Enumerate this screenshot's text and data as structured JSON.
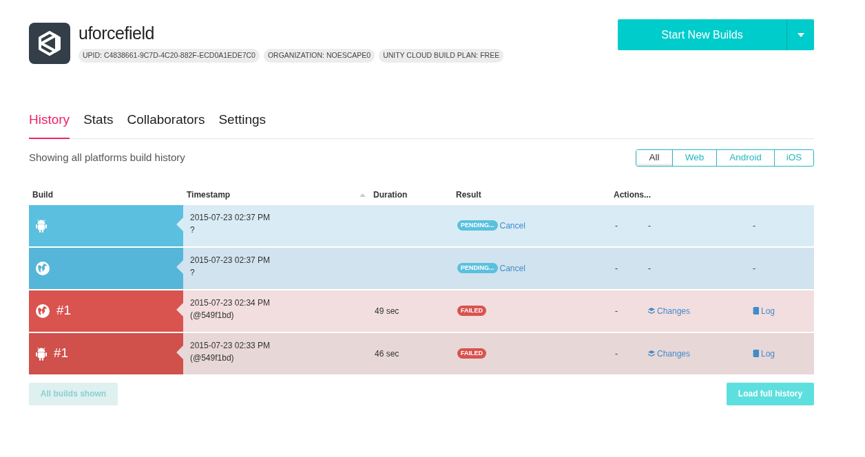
{
  "project": {
    "name": "uforcefield",
    "tags": [
      "UPID: C4838661-9C7D-4C20-882F-ECD0A1EDE7C0",
      "ORGANIZATION: NOESCAPE0",
      "UNITY CLOUD BUILD PLAN: FREE"
    ]
  },
  "start_button": {
    "label": "Start New Builds"
  },
  "tabs": [
    {
      "label": "History",
      "selected": true
    },
    {
      "label": "Stats",
      "selected": false
    },
    {
      "label": "Collaborators",
      "selected": false
    },
    {
      "label": "Settings",
      "selected": false
    }
  ],
  "subtitle": "Showing all platforms build history",
  "filters": [
    {
      "label": "All",
      "selected": true
    },
    {
      "label": "Web",
      "selected": false
    },
    {
      "label": "Android",
      "selected": false
    },
    {
      "label": "iOS",
      "selected": false
    }
  ],
  "table": {
    "columns": [
      {
        "label": "Build",
        "sorted": false
      },
      {
        "label": "Timestamp",
        "sorted": true
      },
      {
        "label": "Duration",
        "sorted": false
      },
      {
        "label": "Result",
        "sorted": false
      },
      {
        "label": "Actions...",
        "sorted": false
      }
    ],
    "rows": [
      {
        "kind": "android",
        "number": "",
        "timestamp": "2015-07-23 02:37 PM",
        "commit": "?",
        "duration": "",
        "status": {
          "kind": "pending",
          "label": "PENDING..."
        },
        "cancel": "Cancel",
        "actions": [
          {
            "kind": "text",
            "label": "-"
          },
          {
            "kind": "text",
            "label": "-"
          },
          {
            "kind": "text",
            "label": "-"
          }
        ]
      },
      {
        "kind": "web",
        "number": "",
        "timestamp": "2015-07-23 02:37 PM",
        "commit": "?",
        "duration": "",
        "status": {
          "kind": "pending",
          "label": "PENDING..."
        },
        "cancel": "Cancel",
        "actions": [
          {
            "kind": "text",
            "label": "-"
          },
          {
            "kind": "text",
            "label": "-"
          },
          {
            "kind": "text",
            "label": "-"
          }
        ]
      },
      {
        "kind": "web",
        "number": "#1",
        "timestamp": "2015-07-23 02:34 PM",
        "commit": "(@549f1bd)",
        "duration": "49 sec",
        "status": {
          "kind": "failed",
          "label": "FAILED"
        },
        "cancel": "",
        "actions": [
          {
            "kind": "text",
            "label": "-"
          },
          {
            "kind": "changes",
            "label": "Changes"
          },
          {
            "kind": "log",
            "label": "Log"
          }
        ]
      },
      {
        "kind": "android",
        "number": "#1",
        "timestamp": "2015-07-23 02:33 PM",
        "commit": "(@549f1bd)",
        "duration": "46 sec",
        "status": {
          "kind": "failed",
          "label": "FAILED"
        },
        "cancel": "",
        "actions": [
          {
            "kind": "text",
            "label": "-"
          },
          {
            "kind": "changes",
            "label": "Changes"
          },
          {
            "kind": "log",
            "label": "Log"
          }
        ]
      }
    ]
  },
  "footer_buttons": [
    {
      "label": "All builds shown",
      "disabled": true
    },
    {
      "label": "Load full history",
      "disabled": false
    }
  ]
}
